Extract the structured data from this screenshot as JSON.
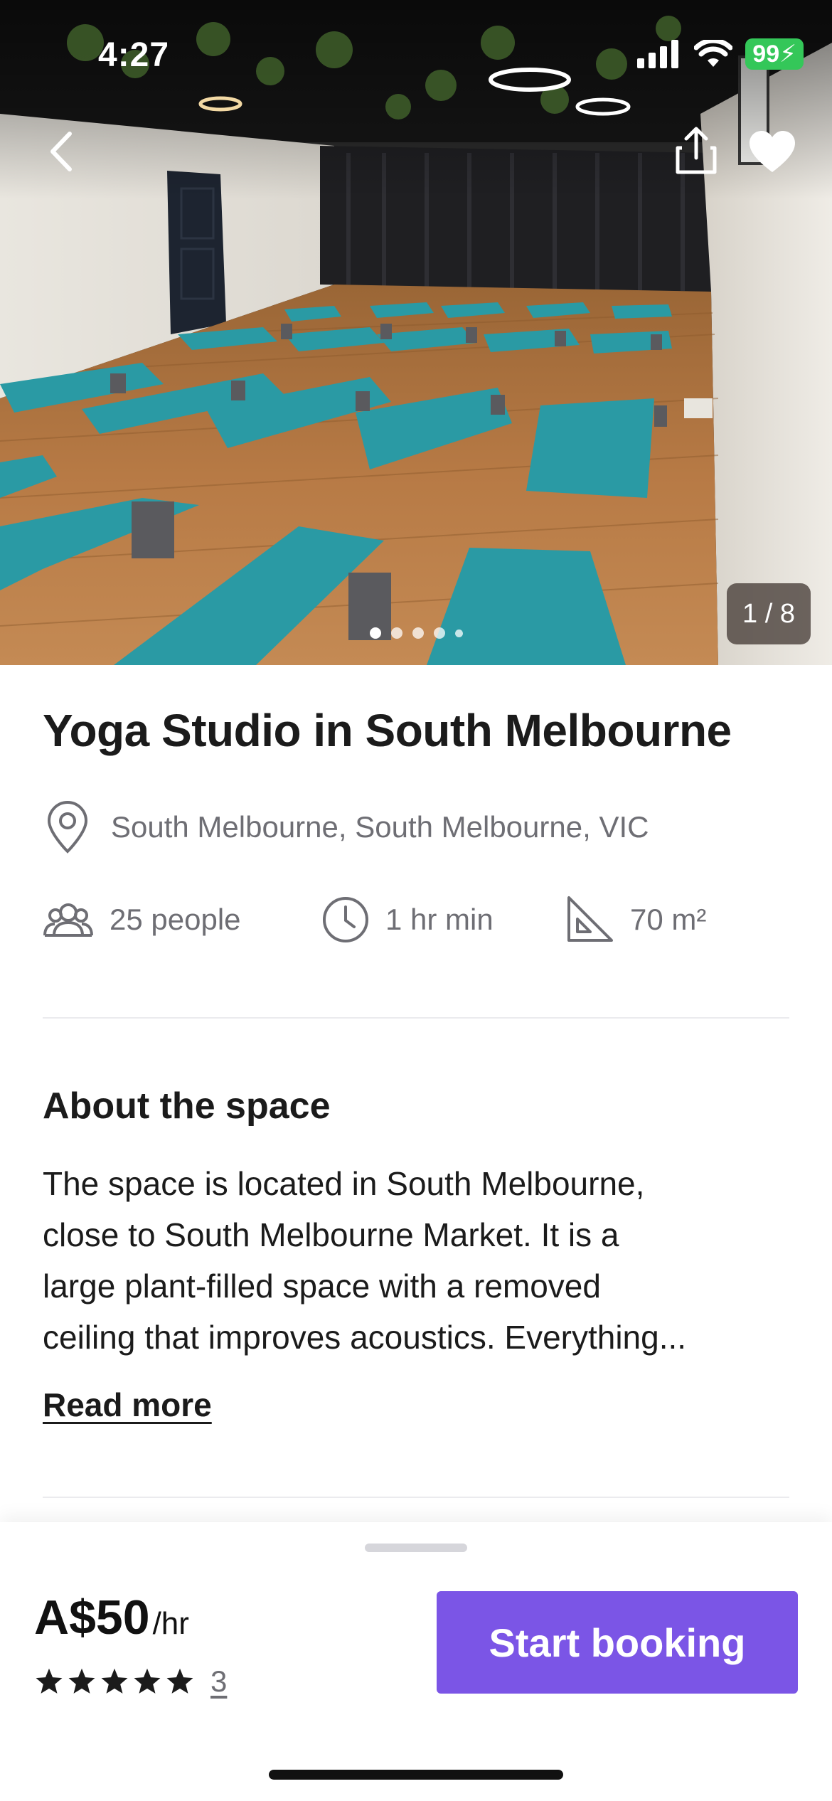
{
  "status_bar": {
    "time": "4:27",
    "battery": "99"
  },
  "hero": {
    "counter": "1 / 8",
    "dots_total": 5,
    "dots_active_index": 0
  },
  "listing": {
    "title": "Yoga Studio in South Melbourne",
    "location": "South Melbourne, South Melbourne, VIC",
    "capacity": "25 people",
    "duration": "1 hr min",
    "area": "70 m²"
  },
  "about": {
    "heading": "About the space",
    "lines": [
      "The space is located in South Melbourne,",
      "close to South Melbourne Market.  It is a",
      "large plant-filled space with a removed",
      "ceiling that improves acoustics.  Everything..."
    ],
    "read_more": "Read more"
  },
  "booking": {
    "price": "A$50",
    "unit": "/hr",
    "rating_stars": 5,
    "review_count": "3",
    "button": "Start booking"
  },
  "colors": {
    "accent": "#7b55e6",
    "battery": "#34c759",
    "muted_text": "#6e6e74",
    "mat_teal": "#2a9aa4",
    "floor_wood": "#b77a45"
  },
  "icons": {
    "back": "chevron-left-icon",
    "share": "share-icon",
    "favorite": "heart-icon",
    "location": "map-pin-icon",
    "capacity": "people-icon",
    "duration": "clock-icon",
    "area": "set-square-icon",
    "rating": "star-icon"
  }
}
